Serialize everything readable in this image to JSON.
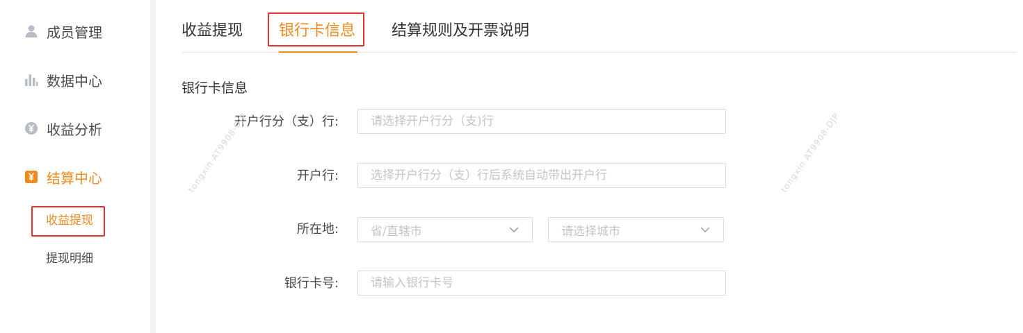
{
  "sidebar": {
    "items": [
      {
        "label": "成员管理",
        "icon": "user-icon"
      },
      {
        "label": "数据中心",
        "icon": "bar-chart-icon"
      },
      {
        "label": "收益分析",
        "icon": "yen-circle-icon"
      },
      {
        "label": "结算中心",
        "icon": "yen-square-icon"
      }
    ],
    "sub_items": [
      {
        "label": "收益提现"
      },
      {
        "label": "提现明细"
      }
    ]
  },
  "tabs": [
    {
      "label": "收益提现"
    },
    {
      "label": "银行卡信息"
    },
    {
      "label": "结算规则及开票说明"
    }
  ],
  "form": {
    "section_title": "银行卡信息",
    "branch": {
      "label": "开户行分（支）行:",
      "placeholder": "请选择开户行分（支)行"
    },
    "bank": {
      "label": "开户行:",
      "placeholder": "选择开户行分（支）行后系统自动带出开户行"
    },
    "location": {
      "label": "所在地:",
      "province_placeholder": "省/直辖市",
      "city_placeholder": "请选择城市"
    },
    "card_number": {
      "label": "银行卡号:",
      "placeholder": "请输入银行卡号"
    }
  },
  "watermark": "tongxin  AT9908-DJP",
  "colors": {
    "accent": "#f08a1e",
    "highlight": "#e8302a"
  }
}
